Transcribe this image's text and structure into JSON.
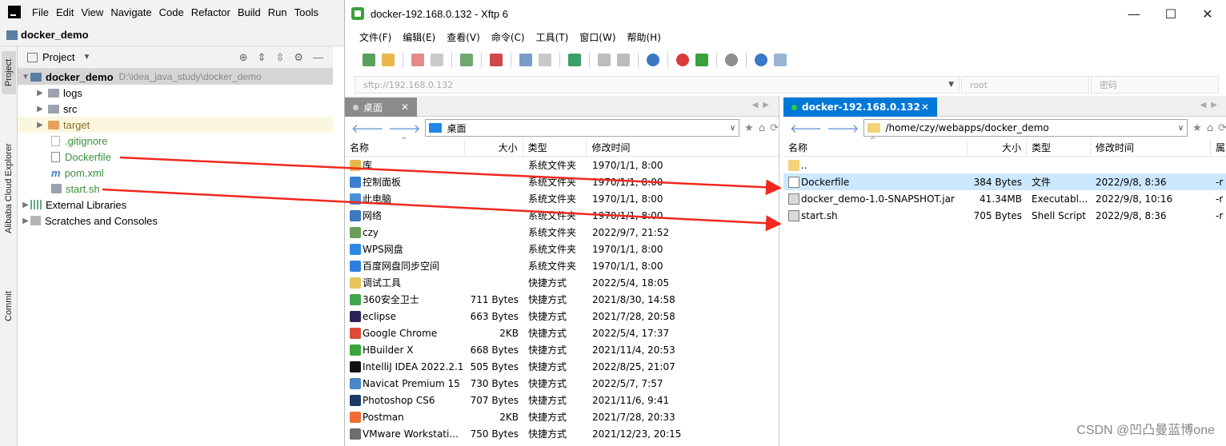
{
  "intellij": {
    "menu": [
      "File",
      "Edit",
      "View",
      "Navigate",
      "Code",
      "Refactor",
      "Build",
      "Run",
      "Tools"
    ],
    "project_name": "docker_demo",
    "side_tabs": {
      "project": "Project",
      "alibaba": "Alibaba Cloud Explorer",
      "commit": "Commit"
    },
    "toolwindow_title": "Project",
    "tree": {
      "root_name": "docker_demo",
      "root_path": "D:\\idea_java_study\\docker_demo",
      "logs": "logs",
      "src": "src",
      "target": "target",
      "gitignore": ".gitignore",
      "dockerfile": "Dockerfile",
      "pom": "pom.xml",
      "start": "start.sh",
      "external": "External Libraries",
      "scratches": "Scratches and Consoles"
    }
  },
  "xftp": {
    "title": "docker-192.168.0.132   - Xftp 6",
    "menu": [
      "文件(F)",
      "编辑(E)",
      "查看(V)",
      "命令(C)",
      "工具(T)",
      "窗口(W)",
      "帮助(H)"
    ],
    "host_placeholder": "sftp://192.168.0.132",
    "user_placeholder": "root",
    "pass_placeholder": "密码",
    "left": {
      "tab_label": "桌面",
      "path": "桌面",
      "headers": {
        "name": "名称",
        "size": "大小",
        "type": "类型",
        "modified": "修改时间"
      },
      "rows": [
        {
          "name": "库",
          "size": "",
          "type": "系统文件夹",
          "modified": "1970/1/1, 8:00",
          "color": "#e8b84a"
        },
        {
          "name": "控制面板",
          "size": "",
          "type": "系统文件夹",
          "modified": "1970/1/1, 8:00",
          "color": "#3b7fd1"
        },
        {
          "name": "此电脑",
          "size": "",
          "type": "系统文件夹",
          "modified": "1970/1/1, 8:00",
          "color": "#4a90d9"
        },
        {
          "name": "网络",
          "size": "",
          "type": "系统文件夹",
          "modified": "1970/1/1, 8:00",
          "color": "#3a78c2"
        },
        {
          "name": "czy",
          "size": "",
          "type": "系统文件夹",
          "modified": "2022/9/7, 21:52",
          "color": "#6a9f5a"
        },
        {
          "name": "WPS网盘",
          "size": "",
          "type": "系统文件夹",
          "modified": "1970/1/1, 8:00",
          "color": "#2b8ae0"
        },
        {
          "name": "百度网盘同步空间",
          "size": "",
          "type": "系统文件夹",
          "modified": "1970/1/1, 8:00",
          "color": "#2f7fe0"
        },
        {
          "name": "调试工具",
          "size": "",
          "type": "快捷方式",
          "modified": "2022/5/4, 18:05",
          "color": "#e8c25a"
        },
        {
          "name": "360安全卫士",
          "size": "711 Bytes",
          "type": "快捷方式",
          "modified": "2021/8/30, 14:58",
          "color": "#3fa64a"
        },
        {
          "name": "eclipse",
          "size": "663 Bytes",
          "type": "快捷方式",
          "modified": "2021/7/28, 20:58",
          "color": "#2c2255"
        },
        {
          "name": "Google Chrome",
          "size": "2KB",
          "type": "快捷方式",
          "modified": "2022/5/4, 17:37",
          "color": "#dd4b39"
        },
        {
          "name": "HBuilder X",
          "size": "668 Bytes",
          "type": "快捷方式",
          "modified": "2021/11/4, 20:53",
          "color": "#3aa53a"
        },
        {
          "name": "IntelliJ IDEA 2022.2.1",
          "size": "505 Bytes",
          "type": "快捷方式",
          "modified": "2022/8/25, 21:07",
          "color": "#111111"
        },
        {
          "name": "Navicat Premium 15",
          "size": "730 Bytes",
          "type": "快捷方式",
          "modified": "2022/5/7, 7:57",
          "color": "#4a86c5"
        },
        {
          "name": "Photoshop CS6",
          "size": "707 Bytes",
          "type": "快捷方式",
          "modified": "2021/11/6, 9:41",
          "color": "#1b3a6a"
        },
        {
          "name": "Postman",
          "size": "2KB",
          "type": "快捷方式",
          "modified": "2021/7/28, 20:33",
          "color": "#ef6c35"
        },
        {
          "name": "VMware Workstati...",
          "size": "750 Bytes",
          "type": "快捷方式",
          "modified": "2021/12/23, 20:15",
          "color": "#6e6e6e"
        }
      ]
    },
    "right": {
      "tab_label": "docker-192.168.0.132",
      "path": "/home/czy/webapps/docker_demo",
      "headers": {
        "name": "名称",
        "size": "大小",
        "type": "类型",
        "modified": "修改时间",
        "perm": "属"
      },
      "rows": [
        {
          "name": "..",
          "size": "",
          "type": "",
          "modified": "",
          "perm": "",
          "color": "#f3d27a"
        },
        {
          "name": "Dockerfile",
          "size": "384 Bytes",
          "type": "文件",
          "modified": "2022/9/8, 8:36",
          "perm": "-r",
          "color": "#ffffff"
        },
        {
          "name": "docker_demo-1.0-SNAPSHOT.jar",
          "size": "41.34MB",
          "type": "Executabl...",
          "modified": "2022/9/8, 10:16",
          "perm": "-r",
          "color": "#d9d9d9"
        },
        {
          "name": "start.sh",
          "size": "705 Bytes",
          "type": "Shell Script",
          "modified": "2022/9/8, 8:36",
          "perm": "-r",
          "color": "#d9d9d9"
        }
      ]
    }
  },
  "watermark": "CSDN @凹凸曼蓝博one",
  "colors": {
    "accent": "#0078d7",
    "selection": "#cce8ff",
    "arrow": "#f0281e",
    "ij_green": "#3a8f3a"
  }
}
